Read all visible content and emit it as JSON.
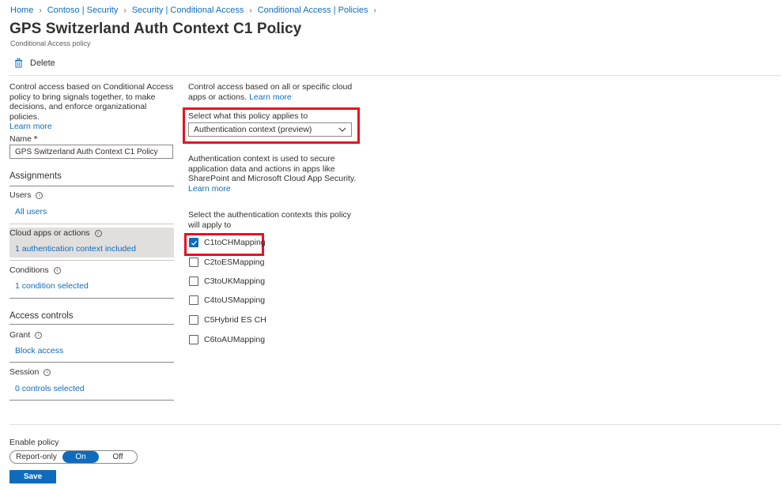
{
  "breadcrumb": [
    "Home",
    "Contoso | Security",
    "Security | Conditional Access",
    "Conditional Access | Policies"
  ],
  "page": {
    "title": "GPS Switzerland Auth Context C1 Policy",
    "more": "...",
    "subtitle": "Conditional Access policy"
  },
  "toolbar": {
    "delete_label": "Delete"
  },
  "left": {
    "description": "Control access based on Conditional Access policy to bring signals together, to make decisions, and enforce organizational policies.",
    "learn_more": "Learn more",
    "name_label": "Name",
    "name_required": "*",
    "name_value": "GPS Switzerland Auth Context C1 Policy",
    "assignments_heading": "Assignments",
    "users_label": "Users",
    "users_value": "All users",
    "cloud_apps_label": "Cloud apps or actions",
    "cloud_apps_value": "1 authentication context included",
    "conditions_label": "Conditions",
    "conditions_value": "1 condition selected",
    "access_controls_heading": "Access controls",
    "grant_label": "Grant",
    "grant_value": "Block access",
    "session_label": "Session",
    "session_value": "0 controls selected"
  },
  "right": {
    "description": "Control access based on all or specific cloud apps or actions.",
    "learn_more": "Learn more",
    "applies_label": "Select what this policy applies to",
    "applies_value": "Authentication context (preview)",
    "auth_desc": "Authentication context is used to secure application data and actions in apps like SharePoint and Microsoft Cloud App Security.",
    "auth_learn_more": "Learn more",
    "select_contexts_label": "Select the authentication contexts this policy will apply to",
    "contexts": [
      {
        "label": "C1toCHMapping",
        "checked": true
      },
      {
        "label": "C2toESMapping",
        "checked": false
      },
      {
        "label": "C3toUKMapping",
        "checked": false
      },
      {
        "label": "C4toUSMapping",
        "checked": false
      },
      {
        "label": "C5Hybrid ES CH",
        "checked": false
      },
      {
        "label": "C6toAUMapping",
        "checked": false
      }
    ]
  },
  "footer": {
    "enable_label": "Enable policy",
    "toggle_options": [
      "Report-only",
      "On",
      "Off"
    ],
    "toggle_selected": "On",
    "save_label": "Save"
  },
  "colors": {
    "accent": "#0f6cbd",
    "highlight_box": "#e81123"
  }
}
